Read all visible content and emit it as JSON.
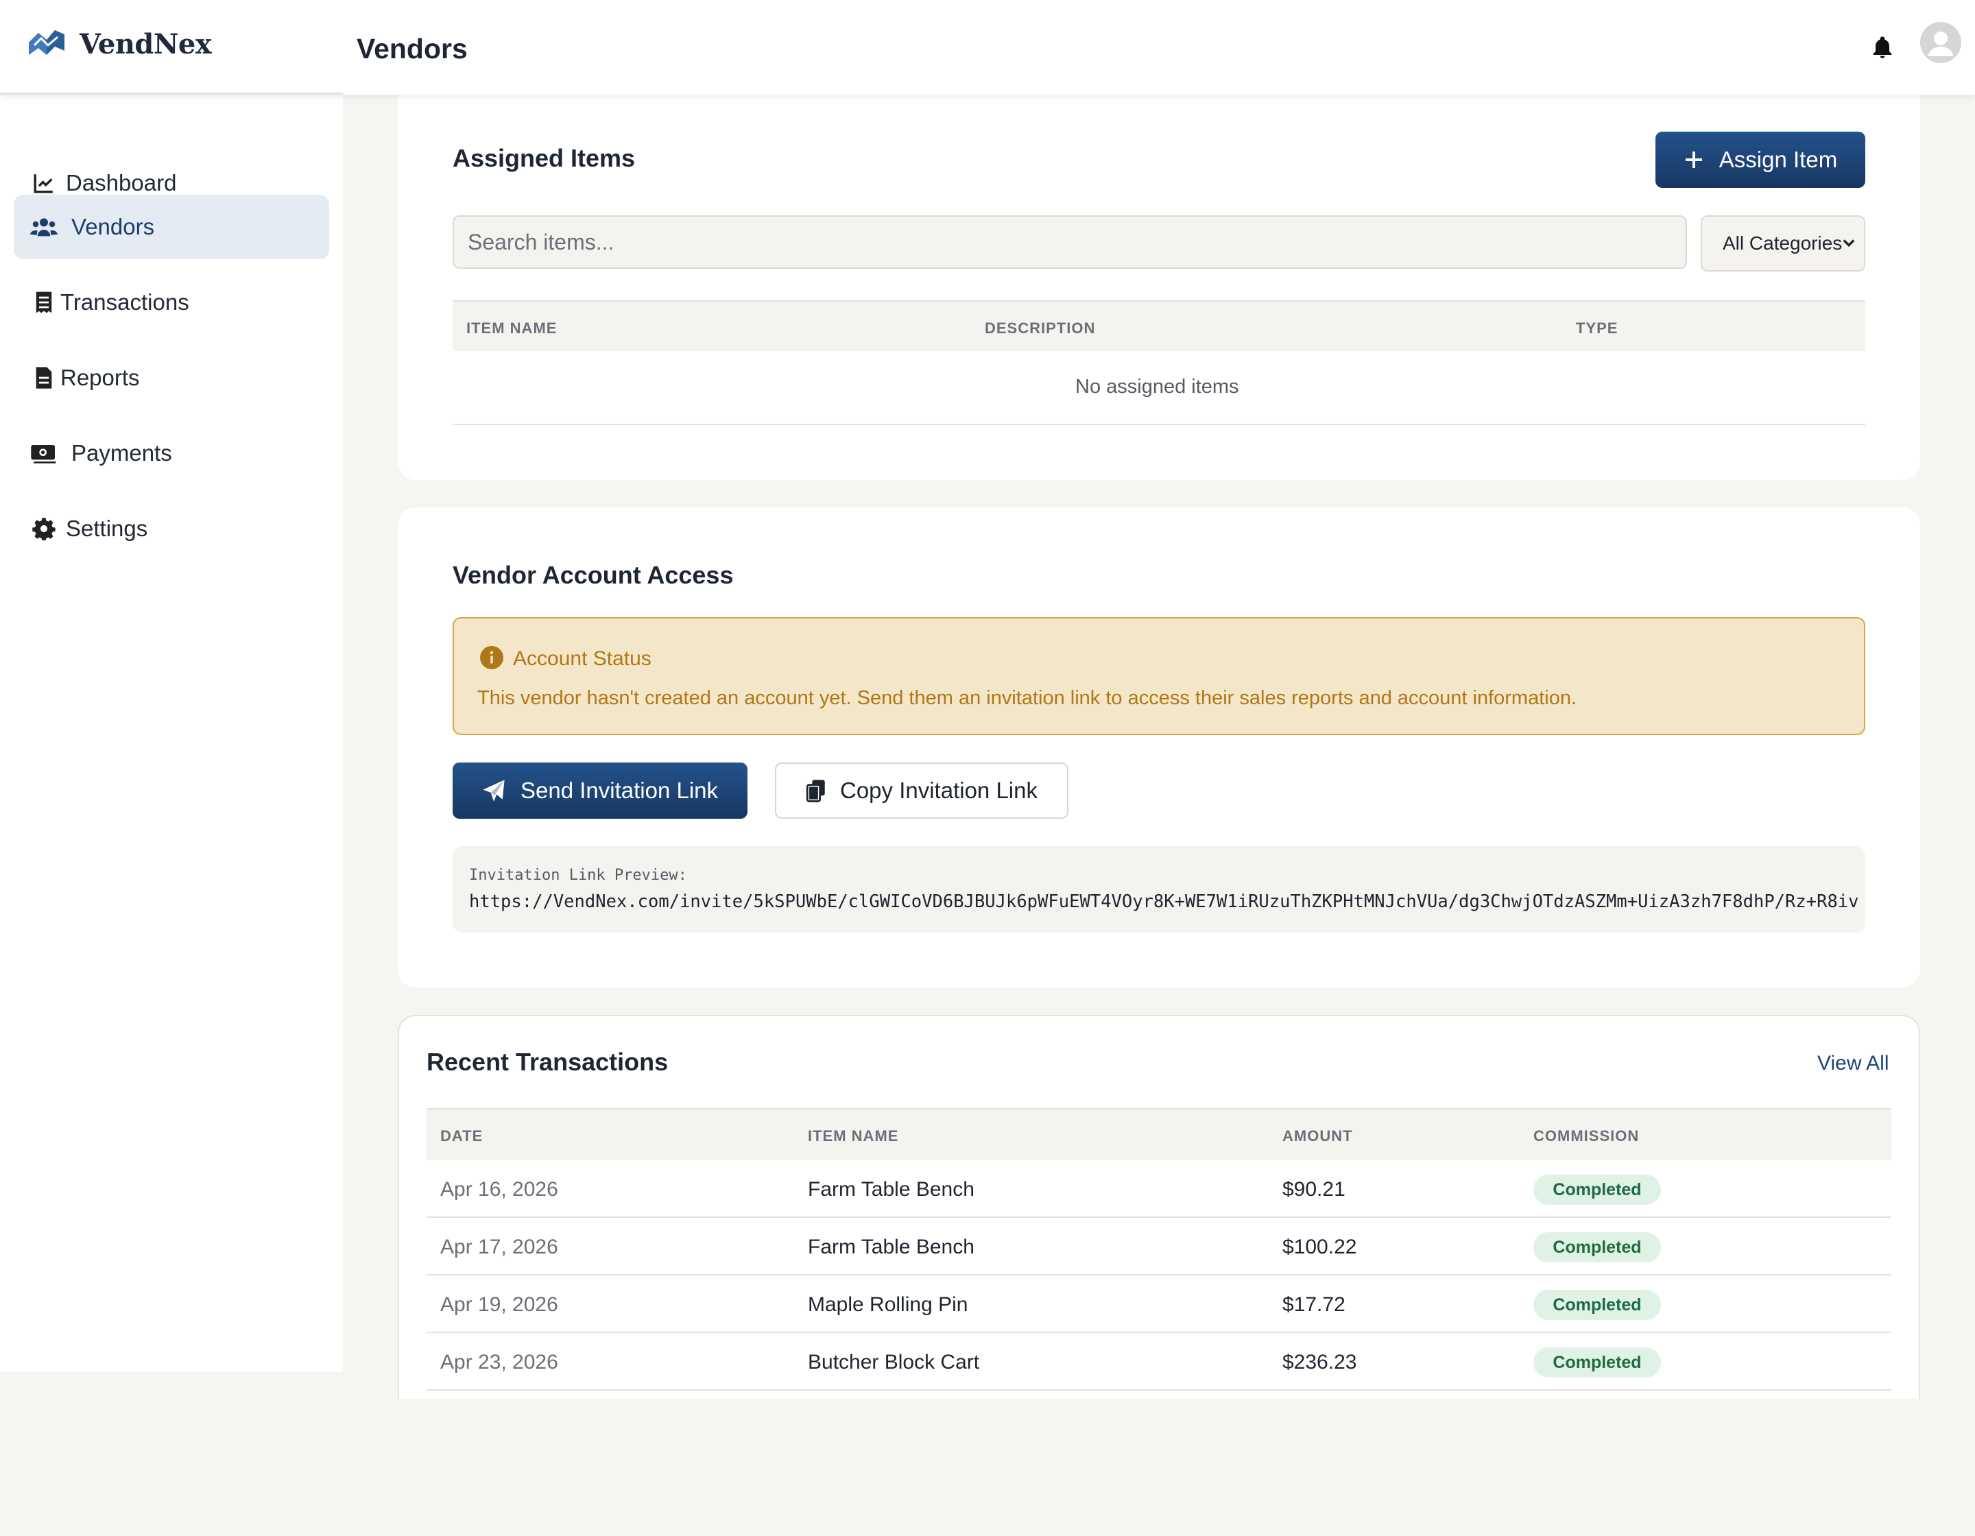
{
  "app": {
    "name": "VendNex"
  },
  "header": {
    "title": "Vendors",
    "notifications_icon": "bell-icon",
    "avatar_icon": "user-avatar-icon"
  },
  "sidebar": {
    "items": [
      {
        "label": "Dashboard",
        "icon": "chart-line-icon"
      },
      {
        "label": "Vendors",
        "icon": "users-icon",
        "active": true
      },
      {
        "label": "Transactions",
        "icon": "receipt-icon"
      },
      {
        "label": "Reports",
        "icon": "file-icon"
      },
      {
        "label": "Payments",
        "icon": "money-icon"
      },
      {
        "label": "Settings",
        "icon": "gear-icon"
      }
    ]
  },
  "assigned_items": {
    "title": "Assigned Items",
    "assign_button": "Assign Item",
    "search_placeholder": "Search items...",
    "category_select": "All Categories",
    "columns": [
      "ITEM NAME",
      "DESCRIPTION",
      "TYPE"
    ],
    "empty_text": "No assigned items"
  },
  "account_access": {
    "title": "Vendor Account Access",
    "alert_title": "Account Status",
    "alert_text": "This vendor hasn't created an account yet. Send them an invitation link to access their sales reports and account information.",
    "send_button": "Send Invitation Link",
    "copy_button": "Copy Invitation Link",
    "preview_label": "Invitation Link Preview:",
    "preview_url": "https://VendNex.com/invite/5kSPUWbE/clGWICoVD6BJBUJk6pWFuEWT4VOyr8K+WE7W1iRUzuThZKPHtMNJchVUa/dg3ChwjOTdzASZMm+UizA3zh7F8dhP/Rz+R8iv"
  },
  "transactions": {
    "title": "Recent Transactions",
    "view_all": "View All",
    "columns": [
      "DATE",
      "ITEM NAME",
      "AMOUNT",
      "COMMISSION"
    ],
    "rows": [
      {
        "date": "Apr 16, 2026",
        "item": "Farm Table Bench",
        "amount": "$90.21",
        "status": "Completed"
      },
      {
        "date": "Apr 17, 2026",
        "item": "Farm Table Bench",
        "amount": "$100.22",
        "status": "Completed"
      },
      {
        "date": "Apr 19, 2026",
        "item": "Maple Rolling Pin",
        "amount": "$17.72",
        "status": "Completed"
      },
      {
        "date": "Apr 23, 2026",
        "item": "Butcher Block Cart",
        "amount": "$236.23",
        "status": "Completed"
      }
    ]
  },
  "colors": {
    "primary": "#1d3d6b",
    "warning_bg": "#f4e6c8",
    "warning_text": "#b07718",
    "success_bg": "#e0f2e6",
    "success_text": "#1d6b3e"
  }
}
